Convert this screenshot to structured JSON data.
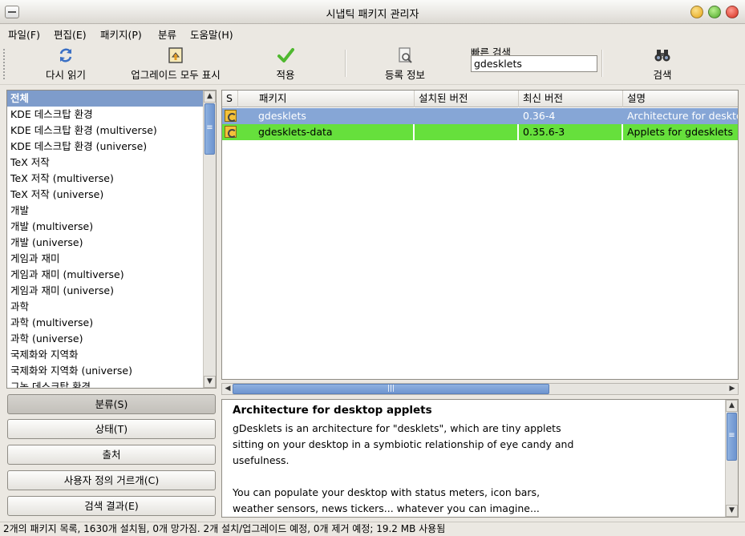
{
  "window": {
    "title": "시냅틱 패키지 관리자"
  },
  "menubar": {
    "items": [
      "파일(F)",
      "편집(E)",
      "패키지(P)",
      "분류",
      "도움말(H)"
    ]
  },
  "toolbar": {
    "reload": "다시 읽기",
    "mark_upgrades": "업그레이드 모두 표시",
    "apply": "적용",
    "properties": "등록 정보",
    "quick_search_label": "빠른 검색",
    "quick_search_value": "gdesklets",
    "search": "검색"
  },
  "categories": [
    "전체",
    "KDE 데스크탑 환경",
    "KDE 데스크탑 환경 (multiverse)",
    "KDE 데스크탑 환경 (universe)",
    "TeX 저작",
    "TeX 저작 (multiverse)",
    "TeX 저작 (universe)",
    "개발",
    "개발 (multiverse)",
    "개발 (universe)",
    "게임과 재미",
    "게임과 재미 (multiverse)",
    "게임과 재미 (universe)",
    "과학",
    "과학 (multiverse)",
    "과학 (universe)",
    "국제화와 지역화",
    "국제화와 지역화 (universe)",
    "그놈 데스크탑 환경"
  ],
  "filters": {
    "sections": "분류(S)",
    "status": "상태(T)",
    "origin": "출처",
    "custom": "사용자 정의 거르개(C)",
    "search_results": "검색 결과(E)"
  },
  "table": {
    "headers": {
      "status": "S",
      "package": "패키지",
      "installed": "설치된 버전",
      "latest": "최신 버전",
      "description": "설명"
    },
    "rows": [
      {
        "package": "gdesklets",
        "installed": "",
        "latest": "0.36-4",
        "description": "Architecture for desktop applets"
      },
      {
        "package": "gdesklets-data",
        "installed": "",
        "latest": "0.35.6-3",
        "description": "Applets for gdesklets"
      }
    ]
  },
  "description": {
    "title": "Architecture for desktop applets",
    "body": "gDesklets is an architecture for \"desklets\", which are tiny applets\nsitting on your desktop in a symbiotic relationship of eye candy and\nusefulness.\n\nYou can populate your desktop with status meters, icon bars,\nweather sensors, news tickers... whatever you can imagine..."
  },
  "status": "2개의 패키지 목록, 1630개 설치됨, 0개 망가짐. 2개 설치/업그레이드 예정, 0개 제거 예정; 19.2 MB 사용됨",
  "colors": {
    "selection": "#7e9ccb",
    "row_selected": "#86a6d6",
    "row_marked": "#66e03c"
  }
}
